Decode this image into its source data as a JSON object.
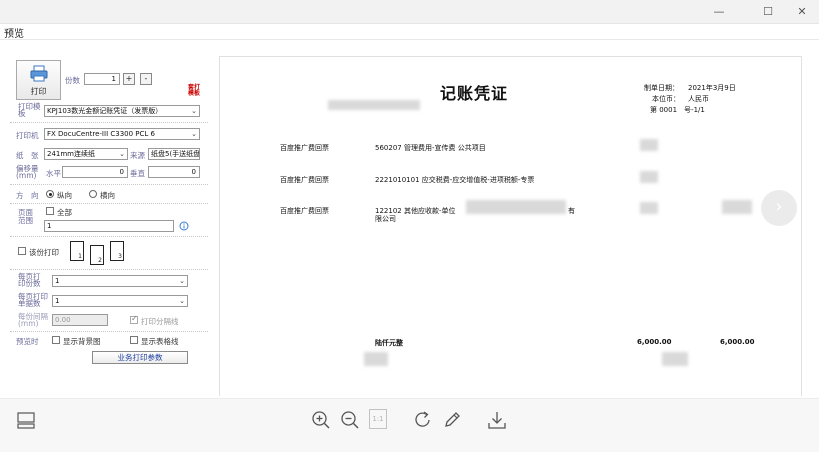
{
  "window": {
    "minimize": "—",
    "maximize": "☐",
    "close": "✕"
  },
  "menu": {
    "title": "预览"
  },
  "panel": {
    "print_label": "打印",
    "copies_label": "份数",
    "copies_value": "1",
    "plus": "+",
    "minus": "-",
    "stamp_text": "套打模板",
    "template_label": "打印模板",
    "template_value": "KPJ103数光金额记账凭证（发票版）",
    "printer_label": "打印机",
    "printer_value": "FX DocuCentre-III C3300 PCL 6",
    "paper_label": "纸　张",
    "paper_value": "241mm连续纸",
    "source_label": "来源",
    "source_value": "纸盘5(手送纸盘",
    "offset_label": "偏移量(mm)",
    "horizontal_label": "水平",
    "horizontal_value": "0",
    "vertical_label": "垂直",
    "vertical_value": "0",
    "direction_label": "方　向",
    "portrait_label": "纵向",
    "landscape_label": "横向",
    "range_label": "页面范围",
    "all_label": "全部",
    "range_value": "1",
    "duplex_label": "该份打印",
    "per_page_copies_label": "每页打印份数",
    "per_page_copies_value": "1",
    "per_page_rows_label": "每页打印单据数",
    "per_page_rows_value": "1",
    "spacing_label": "每份间隔(mm)",
    "spacing_value": "0.00",
    "print_divider_label": "打印分隔线",
    "preview_label": "预览时",
    "show_bg_label": "显示背景图",
    "show_table_label": "显示表格线",
    "biz_params_label": "业务打印参数",
    "page_icon_nums": [
      "1",
      "2",
      "3"
    ]
  },
  "document": {
    "title": "记账凭证",
    "date_label": "制单日期：",
    "date_value": "2021年3月9日",
    "currency_label": "本位币：",
    "currency_value": "人民币",
    "number_label": "第 0001　号-1/1",
    "rows": [
      {
        "summary": "百度推广费回票",
        "account": "560207 管理费用-宣传费 公共项目"
      },
      {
        "summary": "百度推广费回票",
        "account": "2221010101 应交税费-应交增值税-进项税额-专票"
      },
      {
        "summary": "百度推广费回票",
        "account": "122102 其他应收款-单位",
        "account_tail": "有",
        "account_line2": "限公司"
      }
    ],
    "total_label": "陆仟元整",
    "debit_total": "6,000.00",
    "credit_total": "6,000.00"
  },
  "icons": {
    "layout": "layout-icon",
    "zoom_in": "zoom-in-icon",
    "zoom_out": "zoom-out-icon",
    "page": "page-icon",
    "page_text": "1:1",
    "rotate": "rotate-icon",
    "edit": "pencil-icon",
    "download": "download-icon",
    "next": "›"
  }
}
